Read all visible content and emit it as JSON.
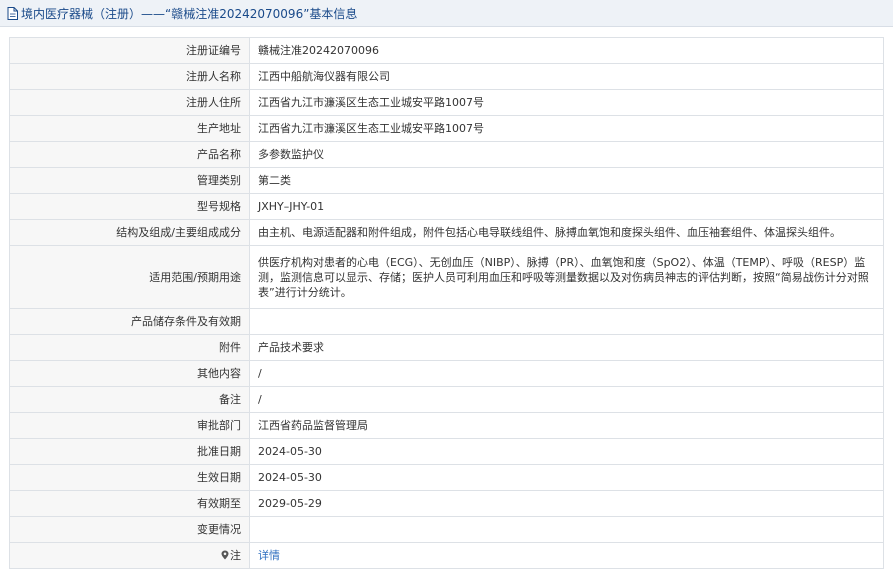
{
  "header": {
    "title": "境内医疗器械（注册）——“赣械注准20242070096”基本信息"
  },
  "rows": [
    {
      "label": "注册证编号",
      "value": "赣械注准20242070096"
    },
    {
      "label": "注册人名称",
      "value": "江西中船航海仪器有限公司"
    },
    {
      "label": "注册人住所",
      "value": "江西省九江市濂溪区生态工业城安平路1007号"
    },
    {
      "label": "生产地址",
      "value": "江西省九江市濂溪区生态工业城安平路1007号"
    },
    {
      "label": "产品名称",
      "value": "多参数监护仪"
    },
    {
      "label": "管理类别",
      "value": "第二类"
    },
    {
      "label": "型号规格",
      "value": "JXHY–JHY-01"
    },
    {
      "label": "结构及组成/主要组成成分",
      "value": "由主机、电源适配器和附件组成，附件包括心电导联线组件、脉搏血氧饱和度探头组件、血压袖套组件、体温探头组件。"
    },
    {
      "label": "适用范围/预期用途",
      "value": "供医疗机构对患者的心电（ECG）、无创血压（NIBP）、脉搏（PR）、血氧饱和度（SpO2）、体温（TEMP）、呼吸（RESP）监测，监测信息可以显示、存储；医护人员可利用血压和呼吸等测量数据以及对伤病员神志的评估判断，按照“简易战伤计分对照表”进行计分统计。"
    },
    {
      "label": "产品储存条件及有效期",
      "value": ""
    },
    {
      "label": "附件",
      "value": "产品技术要求"
    },
    {
      "label": "其他内容",
      "value": "/"
    },
    {
      "label": "备注",
      "value": "/"
    },
    {
      "label": "审批部门",
      "value": "江西省药品监督管理局"
    },
    {
      "label": "批准日期",
      "value": "2024-05-30"
    },
    {
      "label": "生效日期",
      "value": "2024-05-30"
    },
    {
      "label": "有效期至",
      "value": "2029-05-29"
    },
    {
      "label": "变更情况",
      "value": ""
    },
    {
      "label": "注",
      "value": "详情"
    }
  ]
}
